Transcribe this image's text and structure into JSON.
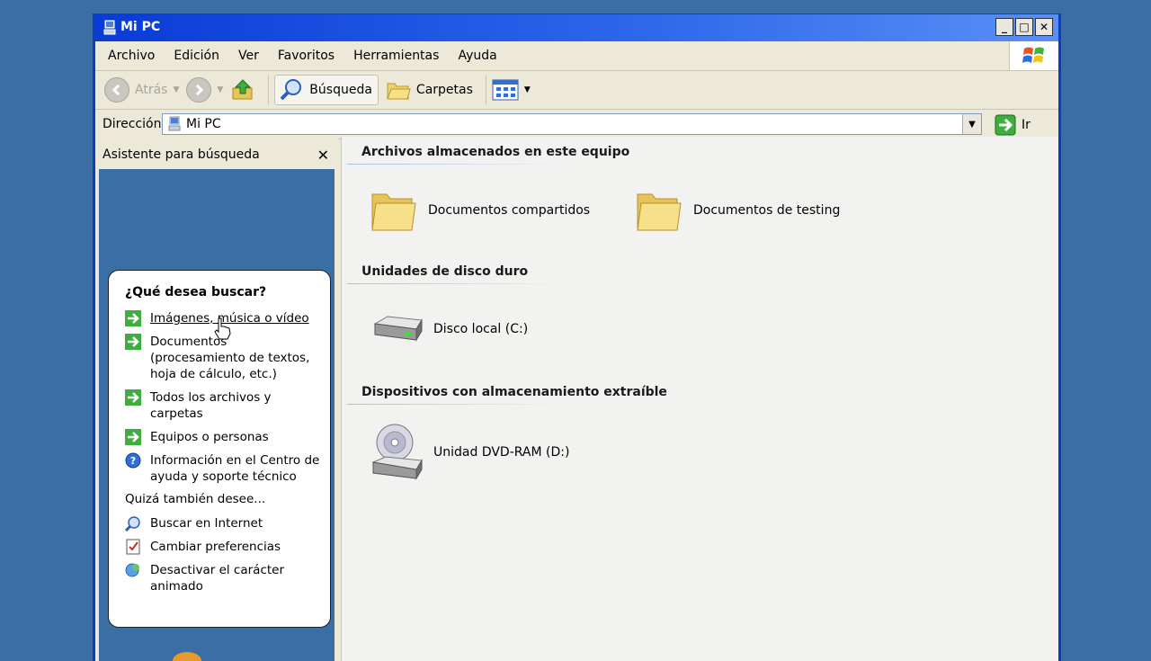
{
  "window": {
    "title": "Mi PC",
    "controls": [
      "minimize",
      "maximize",
      "close"
    ]
  },
  "menu": {
    "items": [
      "Archivo",
      "Edición",
      "Ver",
      "Favoritos",
      "Herramientas",
      "Ayuda"
    ]
  },
  "toolbar": {
    "back_label": "Atrás",
    "search_label": "Búsqueda",
    "folders_label": "Carpetas"
  },
  "address": {
    "label": "Dirección",
    "value": "Mi PC",
    "go_label": "Ir"
  },
  "search_pane": {
    "title": "Asistente para búsqueda",
    "prompt": "¿Qué desea buscar?",
    "options": [
      {
        "label": "Imágenes, música o vídeo",
        "icon": "green-arrow-icon"
      },
      {
        "label": "Documentos (procesamiento de textos, hoja de cálculo, etc.)",
        "icon": "green-arrow-icon"
      },
      {
        "label": "Todos los archivos y carpetas",
        "icon": "green-arrow-icon"
      },
      {
        "label": "Equipos o personas",
        "icon": "green-arrow-icon"
      },
      {
        "label": "Información en el Centro de ayuda y soporte técnico",
        "icon": "help-icon"
      }
    ],
    "also_label": "Quizá también desee...",
    "also_options": [
      {
        "label": "Buscar en Internet",
        "icon": "search-internet-icon"
      },
      {
        "label": "Cambiar preferencias",
        "icon": "preferences-icon"
      },
      {
        "label": "Desactivar el carácter animado",
        "icon": "character-icon"
      }
    ]
  },
  "main": {
    "sections": [
      {
        "title": "Archivos almacenados en este equipo",
        "items": [
          {
            "label": "Documentos compartidos",
            "icon": "folder-icon"
          },
          {
            "label": "Documentos de testing",
            "icon": "folder-icon"
          }
        ]
      },
      {
        "title": "Unidades de disco duro",
        "items": [
          {
            "label": "Disco local (C:)",
            "icon": "hard-drive-icon"
          }
        ]
      },
      {
        "title": "Dispositivos con almacenamiento extraíble",
        "items": [
          {
            "label": "Unidad DVD-RAM (D:)",
            "icon": "dvd-drive-icon"
          }
        ]
      }
    ]
  },
  "colors": {
    "desktop": "#3a6ea5",
    "titlebar": "#0a3bd6",
    "chrome": "#ece9d8"
  }
}
